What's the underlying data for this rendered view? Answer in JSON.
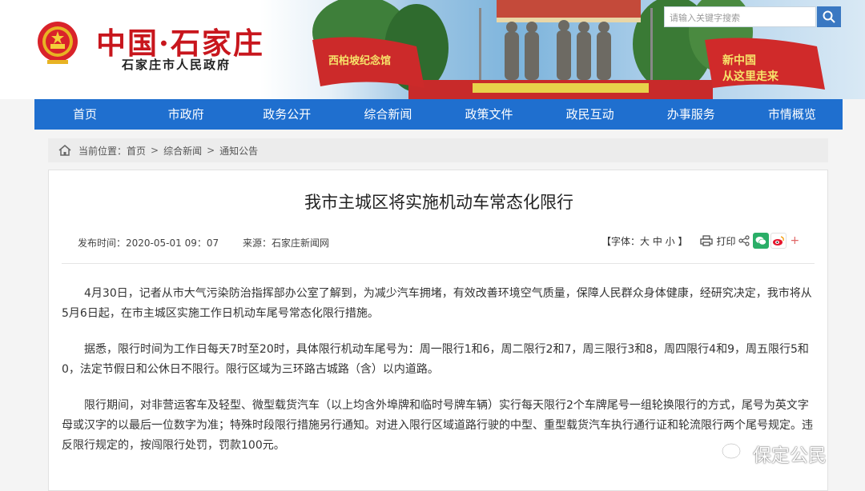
{
  "header": {
    "title": "中国·石家庄",
    "subtitle": "石家庄市人民政府",
    "search_placeholder": "请输入关键字搜索",
    "colors": {
      "title": "#c8161d",
      "nav": "#1f6fcf"
    }
  },
  "nav": {
    "items": [
      {
        "label": "首页"
      },
      {
        "label": "市政府"
      },
      {
        "label": "政务公开"
      },
      {
        "label": "综合新闻"
      },
      {
        "label": "政策文件"
      },
      {
        "label": "政民互动"
      },
      {
        "label": "办事服务"
      },
      {
        "label": "市情概览"
      }
    ]
  },
  "breadcrumb": {
    "prefix": "当前位置：",
    "items": [
      "首页",
      "综合新闻",
      "通知公告"
    ],
    "separator": ">",
    "icon": "home-icon"
  },
  "article": {
    "title": "我市主城区将实施机动车常态化限行",
    "publish_label": "发布时间：",
    "publish_time": "2020-05-01 09：07",
    "source_label": "来源：",
    "source": "石家庄新闻网",
    "font_size": "【字体：大 中 小 】",
    "print": "打印",
    "paragraphs": [
      "4月30日，记者从市大气污染防治指挥部办公室了解到，为减少汽车拥堵，有效改善环境空气质量，保障人民群众身体健康，经研究决定，我市将从5月6日起，在市主城区实施工作日机动车尾号常态化限行措施。",
      "据悉，限行时间为工作日每天7时至20时，具体限行机动车尾号为：周一限行1和6，周二限行2和7，周三限行3和8，周四限行4和9，周五限行5和0，法定节假日和公休日不限行。限行区域为三环路古城路（含）以内道路。",
      "限行期间，对非营运客车及轻型、微型载货汽车（以上均含外埠牌和临时号牌车辆）实行每天限行2个车牌尾号一组轮换限行的方式，尾号为英文字母或汉字的以最后一位数字为准；特殊时段限行措施另行通知。对进入限行区域道路行驶的中型、重型载货汽车执行通行证和轮流限行两个尾号规定。违反限行规定的，按闯限行处罚，罚款100元。"
    ]
  },
  "banner_signs": {
    "left": "西柏坡纪念馆",
    "right_line1": "新中国",
    "right_line2": "从这里走来"
  },
  "watermark": "保定公民"
}
